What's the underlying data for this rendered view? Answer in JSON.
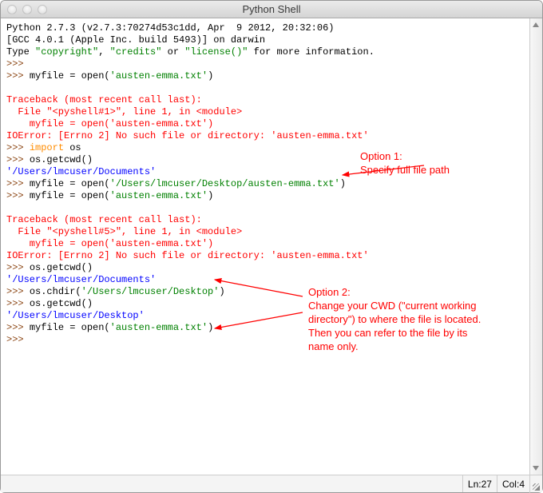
{
  "window": {
    "title": "Python Shell"
  },
  "header": {
    "l1": "Python 2.7.3 (v2.7.3:70274d53c1dd, Apr  9 2012, 20:32:06) ",
    "l2": "[GCC 4.0.1 (Apple Inc. build 5493)] on darwin",
    "l3a": "Type ",
    "l3b": "\"copyright\"",
    "l3c": ", ",
    "l3d": "\"credits\"",
    "l3e": " or ",
    "l3f": "\"license()\"",
    "l3g": " for more information."
  },
  "prompt": ">>> ",
  "code": {
    "p1a": "myfile = open(",
    "p1s": "'austen-emma.txt'",
    "p1b": ")",
    "tb1a": "Traceback (most recent call last):",
    "tb1b": "  File \"<pyshell#1>\", line 1, in <module>",
    "tb1c": "    myfile = open('austen-emma.txt')",
    "tb1d": "IOError: [Errno 2] No such file or directory: 'austen-emma.txt'",
    "imp_kw": "import",
    "imp_mod": " os",
    "cwd_call": "os.getcwd()",
    "cwd_out1": "'/Users/lmcuser/Documents'",
    "open_full_a": "myfile = open(",
    "open_full_s": "'/Users/lmcuser/Desktop/austen-emma.txt'",
    "open_full_b": ")",
    "tb2a": "Traceback (most recent call last):",
    "tb2b": "  File \"<pyshell#5>\", line 1, in <module>",
    "tb2c": "    myfile = open('austen-emma.txt')",
    "tb2d": "IOError: [Errno 2] No such file or directory: 'austen-emma.txt'",
    "chdir_a": "os.chdir(",
    "chdir_s": "'/Users/lmcuser/Desktop'",
    "chdir_b": ")",
    "cwd_out2": "'/Users/lmcuser/Desktop'"
  },
  "annotations": {
    "opt1_title": "Option 1:",
    "opt1_text": "Specify full file path",
    "opt2_title": "Option 2:",
    "opt2_text": "Change your CWD (\"current working directory\") to where the file is located. Then you can refer to the file by its name only."
  },
  "status": {
    "ln_label": "Ln: ",
    "ln_val": "27",
    "col_label": "Col: ",
    "col_val": "4"
  },
  "colors": {
    "annotation": "#ff0000",
    "prompt": "#8b4513",
    "keyword": "#ff8c00",
    "string": "#008000",
    "error": "#ff0000",
    "output": "#0000ff"
  }
}
